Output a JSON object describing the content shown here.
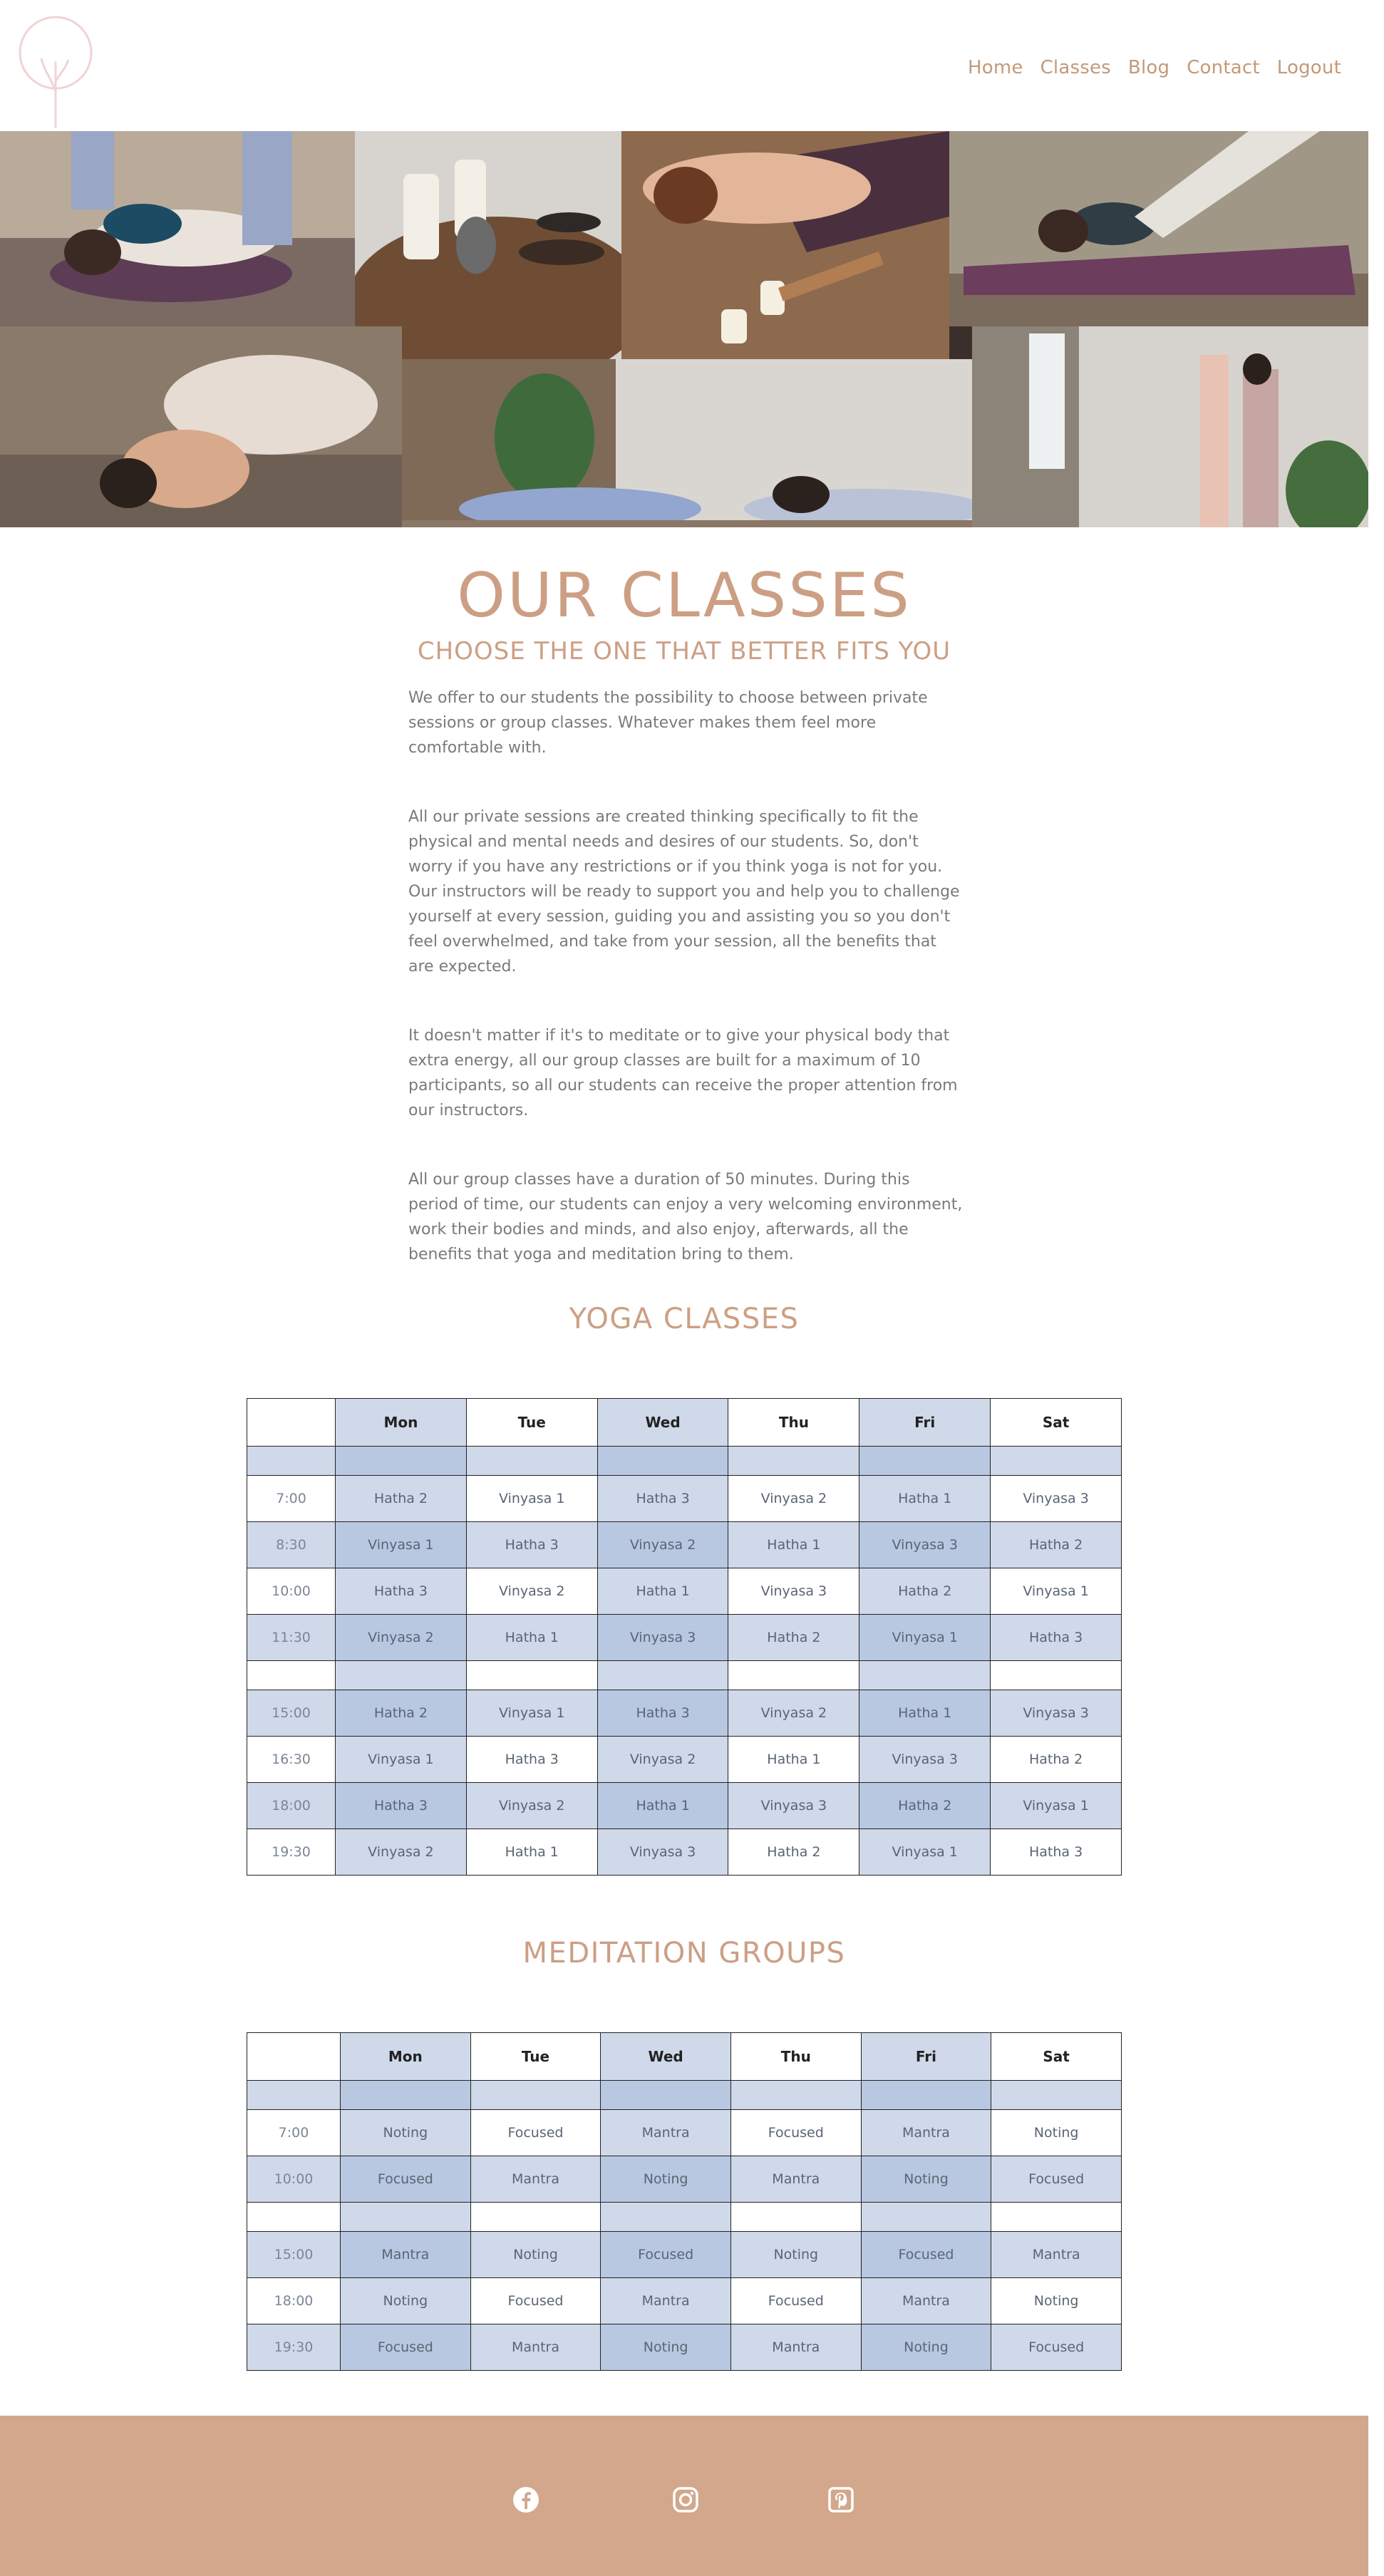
{
  "nav": {
    "items": [
      "Home",
      "Classes",
      "Blog",
      "Contact",
      "Logout"
    ]
  },
  "intro": {
    "title": "OUR CLASSES",
    "subtitle": "CHOOSE THE ONE THAT BETTER FITS YOU",
    "paragraphs": [
      "We offer to our students the possibility to choose between private sessions or group classes. Whatever makes them feel more comfortable with.",
      "All our private sessions are created thinking specifically to fit the physical and mental needs and desires of our students. So, don't worry if you have any restrictions or if you think yoga is not for you. Our instructors will be ready to support you and help you to challenge yourself at every session, guiding you and assisting you so you don't feel overwhelmed, and take from your session, all the benefits that are expected.",
      "It doesn't matter if it's to meditate or to give your physical body that extra energy, all our group classes are built for a maximum of 10 participants, so all our students can receive the proper attention from our instructors.",
      "All our group classes have a duration of 50 minutes. During this period of time, our students can enjoy a very welcoming environment, work their bodies and minds, and also enjoy, afterwards, all the benefits that yoga and meditation bring to them."
    ]
  },
  "yoga": {
    "title": "YOGA CLASSES",
    "days": [
      "Mon",
      "Tue",
      "Wed",
      "Thu",
      "Fri",
      "Sat"
    ],
    "rows": [
      {
        "time": "",
        "cells": [
          "",
          "",
          "",
          "",
          "",
          ""
        ]
      },
      {
        "time": "7:00",
        "cells": [
          "Hatha 2",
          "Vinyasa 1",
          "Hatha 3",
          "Vinyasa 2",
          "Hatha 1",
          "Vinyasa 3"
        ]
      },
      {
        "time": "8:30",
        "cells": [
          "Vinyasa 1",
          "Hatha 3",
          "Vinyasa 2",
          "Hatha 1",
          "Vinyasa 3",
          "Hatha 2"
        ]
      },
      {
        "time": "10:00",
        "cells": [
          "Hatha 3",
          "Vinyasa 2",
          "Hatha 1",
          "Vinyasa 3",
          "Hatha 2",
          "Vinyasa 1"
        ]
      },
      {
        "time": "11:30",
        "cells": [
          "Vinyasa 2",
          "Hatha 1",
          "Vinyasa 3",
          "Hatha 2",
          "Vinyasa 1",
          "Hatha 3"
        ]
      },
      {
        "time": "",
        "cells": [
          "",
          "",
          "",
          "",
          "",
          ""
        ]
      },
      {
        "time": "15:00",
        "cells": [
          "Hatha 2",
          "Vinyasa 1",
          "Hatha 3",
          "Vinyasa 2",
          "Hatha 1",
          "Vinyasa 3"
        ]
      },
      {
        "time": "16:30",
        "cells": [
          "Vinyasa 1",
          "Hatha 3",
          "Vinyasa 2",
          "Hatha 1",
          "Vinyasa 3",
          "Hatha 2"
        ]
      },
      {
        "time": "18:00",
        "cells": [
          "Hatha 3",
          "Vinyasa 2",
          "Hatha 1",
          "Vinyasa 3",
          "Hatha 2",
          "Vinyasa 1"
        ]
      },
      {
        "time": "19:30",
        "cells": [
          "Vinyasa 2",
          "Hatha 1",
          "Vinyasa 3",
          "Hatha 2",
          "Vinyasa 1",
          "Hatha 3"
        ]
      }
    ]
  },
  "meditation": {
    "title": "MEDITATION GROUPS",
    "days": [
      "Mon",
      "Tue",
      "Wed",
      "Thu",
      "Fri",
      "Sat"
    ],
    "rows": [
      {
        "time": "",
        "cells": [
          "",
          "",
          "",
          "",
          "",
          ""
        ]
      },
      {
        "time": "7:00",
        "cells": [
          "Noting",
          "Focused",
          "Mantra",
          "Focused",
          "Mantra",
          "Noting"
        ]
      },
      {
        "time": "10:00",
        "cells": [
          "Focused",
          "Mantra",
          "Noting",
          "Mantra",
          "Noting",
          "Focused"
        ]
      },
      {
        "time": "",
        "cells": [
          "",
          "",
          "",
          "",
          "",
          ""
        ]
      },
      {
        "time": "15:00",
        "cells": [
          "Mantra",
          "Noting",
          "Focused",
          "Noting",
          "Focused",
          "Mantra"
        ]
      },
      {
        "time": "18:00",
        "cells": [
          "Noting",
          "Focused",
          "Mantra",
          "Focused",
          "Mantra",
          "Noting"
        ]
      },
      {
        "time": "19:30",
        "cells": [
          "Focused",
          "Mantra",
          "Noting",
          "Mantra",
          "Noting",
          "Focused"
        ]
      }
    ]
  },
  "footer": {
    "social": [
      "facebook-icon",
      "instagram-icon",
      "pinterest-icon"
    ]
  },
  "colors": {
    "accent": "#cc9f84",
    "nav": "#c39a7a",
    "footer": "#d3a78c",
    "table_light": "#d0d9ea",
    "table_dark": "#b8c8e1"
  }
}
